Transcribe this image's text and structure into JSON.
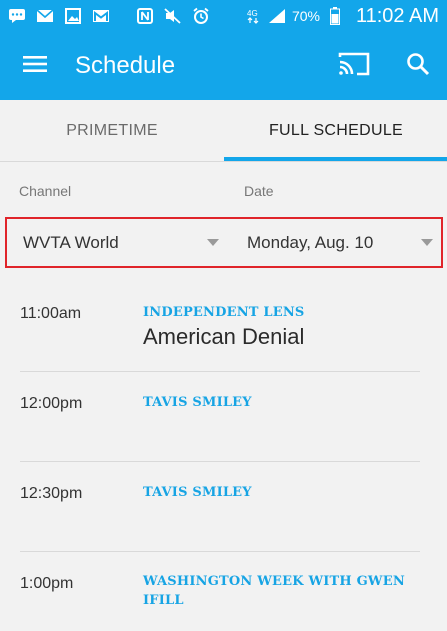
{
  "status_bar": {
    "battery_percent": "70%",
    "time": "11:02 AM",
    "icons": [
      "chat-icon",
      "mail-icon",
      "image-icon",
      "gmail-icon",
      "nfc-icon",
      "mute-icon",
      "alarm-icon",
      "data-4g-icon",
      "signal-icon",
      "battery-icon"
    ]
  },
  "app_bar": {
    "title": "Schedule",
    "icons": [
      "menu-icon",
      "cast-icon",
      "search-icon"
    ]
  },
  "tabs": [
    {
      "label": "PRIMETIME",
      "selected": false
    },
    {
      "label": "FULL SCHEDULE",
      "selected": true
    }
  ],
  "filters": {
    "channel_label": "Channel",
    "channel_value": "WVTA World",
    "date_label": "Date",
    "date_value": "Monday, Aug. 10"
  },
  "schedule": [
    {
      "time": "11:00am",
      "series": "INDEPENDENT LENS",
      "episode": "American Denial"
    },
    {
      "time": "12:00pm",
      "series": "TAVIS SMILEY",
      "episode": ""
    },
    {
      "time": "12:30pm",
      "series": "TAVIS SMILEY",
      "episode": ""
    },
    {
      "time": "1:00pm",
      "series": "WASHINGTON WEEK WITH GWEN IFILL",
      "episode": ""
    }
  ],
  "colors": {
    "primary": "#13a6ea",
    "accent_text": "#17a4e4",
    "highlight_border": "#e0242a",
    "background": "#f2f2f2"
  }
}
